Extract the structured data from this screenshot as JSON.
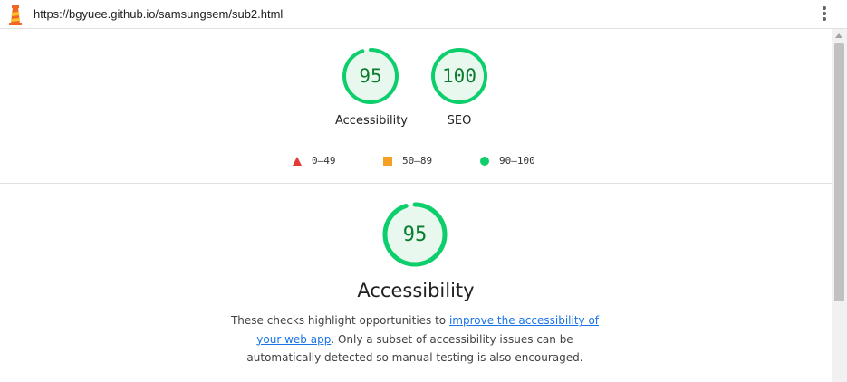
{
  "browser": {
    "url": "https://bgyuee.github.io/samsungsem/sub2.html",
    "logo_icon": "lighthouse-icon",
    "menu_icon": "kebab-menu-icon"
  },
  "summary_gauges": [
    {
      "label": "Accessibility",
      "score": "95",
      "fraction": 0.95
    },
    {
      "label": "SEO",
      "score": "100",
      "fraction": 1.0
    }
  ],
  "legend": [
    {
      "shape": "triangle",
      "range": "0–49",
      "color": "#e53935"
    },
    {
      "shape": "square",
      "range": "50–89",
      "color": "#f4a024"
    },
    {
      "shape": "circle",
      "range": "90–100",
      "color": "#0cce6b"
    }
  ],
  "category": {
    "score": "95",
    "fraction": 0.95,
    "title": "Accessibility",
    "desc_before": "These checks highlight opportunities to ",
    "desc_link": "improve the accessibility of your web app",
    "desc_after": ". Only a subset of accessibility issues can be automatically detected so manual testing is also encouraged."
  },
  "colors": {
    "pass_stroke": "#0cce6b",
    "pass_fill": "#e8f8ee",
    "pass_text": "#0a7c2f"
  }
}
